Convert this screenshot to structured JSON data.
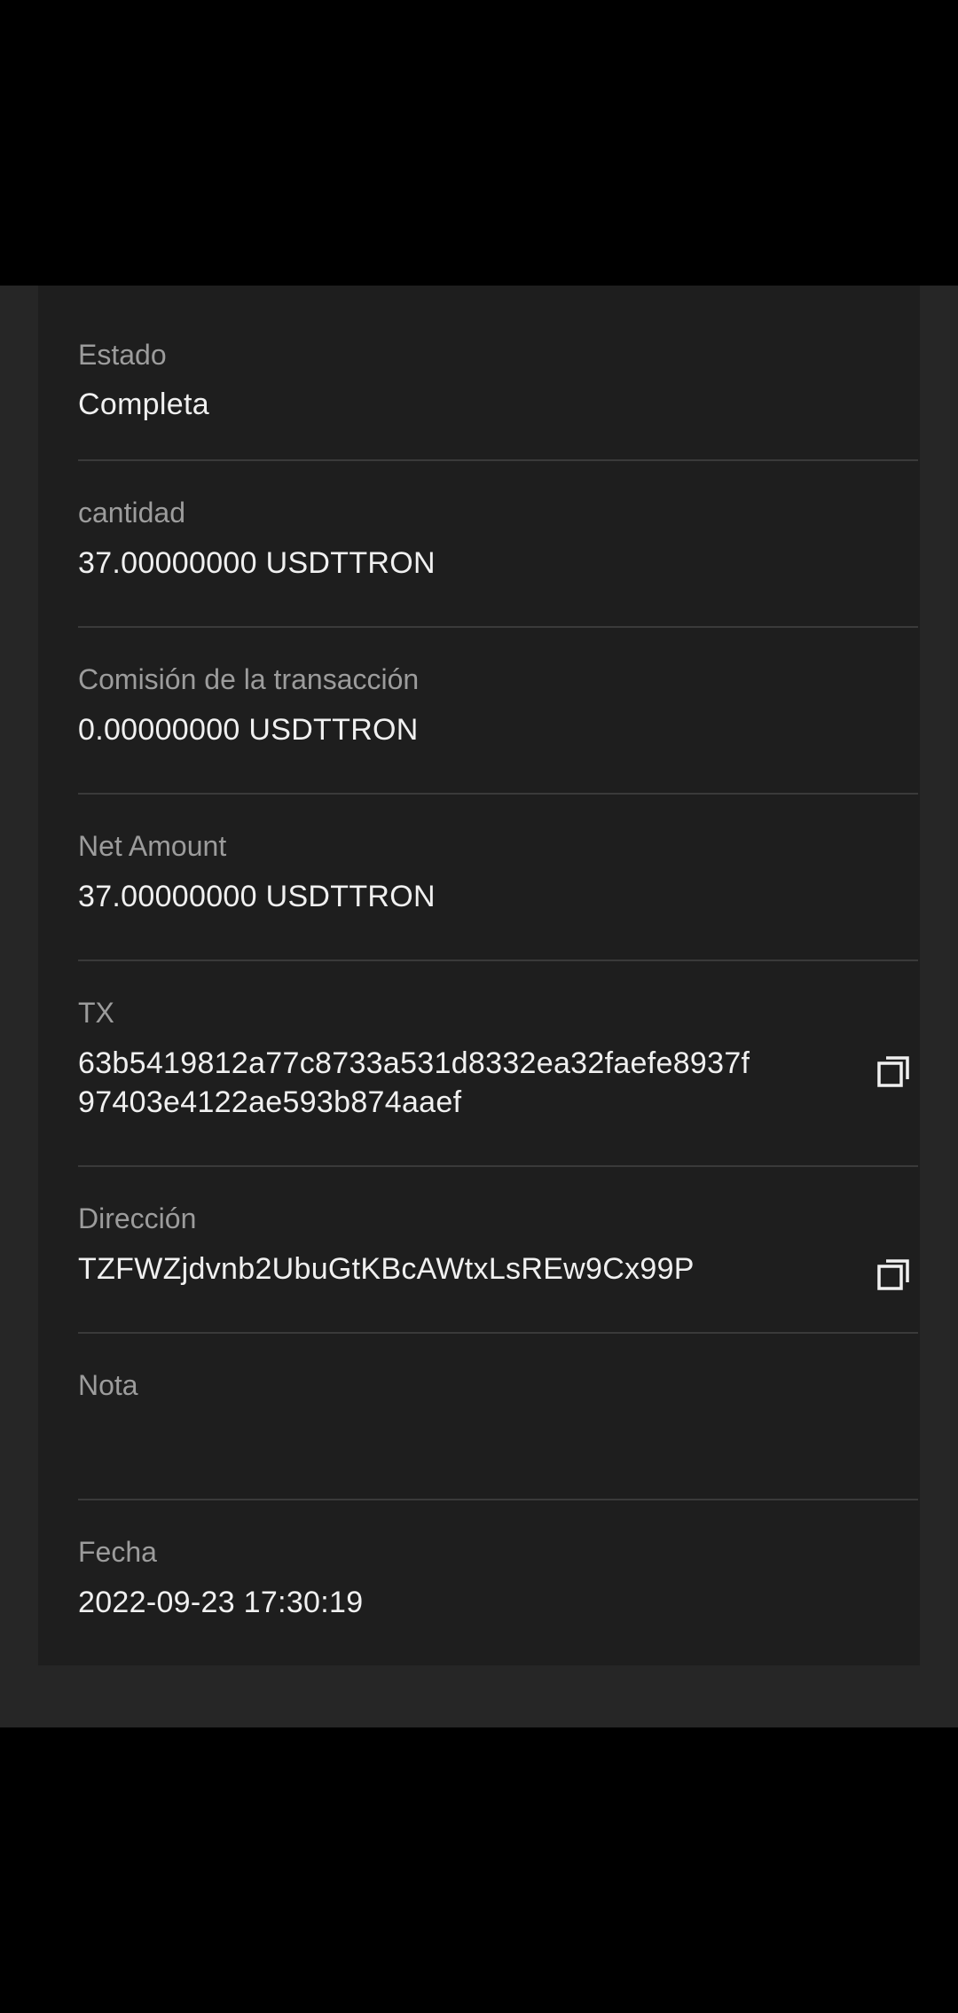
{
  "details": {
    "estado": {
      "label": "Estado",
      "value": "Completa"
    },
    "cantidad": {
      "label": "cantidad",
      "value": "37.00000000 USDTTRON"
    },
    "comision": {
      "label": "Comisión de la transacción",
      "value": "0.00000000 USDTTRON"
    },
    "net_amount": {
      "label": "Net Amount",
      "value": "37.00000000 USDTTRON"
    },
    "tx": {
      "label": "TX",
      "value_line1": "63b5419812a77c8733a531d8332ea32faefe8937f",
      "value_line2": "97403e4122ae593b874aaef"
    },
    "direccion": {
      "label": "Dirección",
      "value": "TZFWZjdvnb2UbuGtKBcAWtxLsREw9Cx99P"
    },
    "nota": {
      "label": "Nota",
      "value": ""
    },
    "fecha": {
      "label": "Fecha",
      "value": "2022-09-23 17:30:19"
    }
  },
  "icons": {
    "copy": "copy-icon"
  },
  "colors": {
    "background": "#262626",
    "card": "#1e1e1e",
    "label": "#9c9c9c",
    "value": "#f0f0f0",
    "divider": "#3a3a3a"
  }
}
